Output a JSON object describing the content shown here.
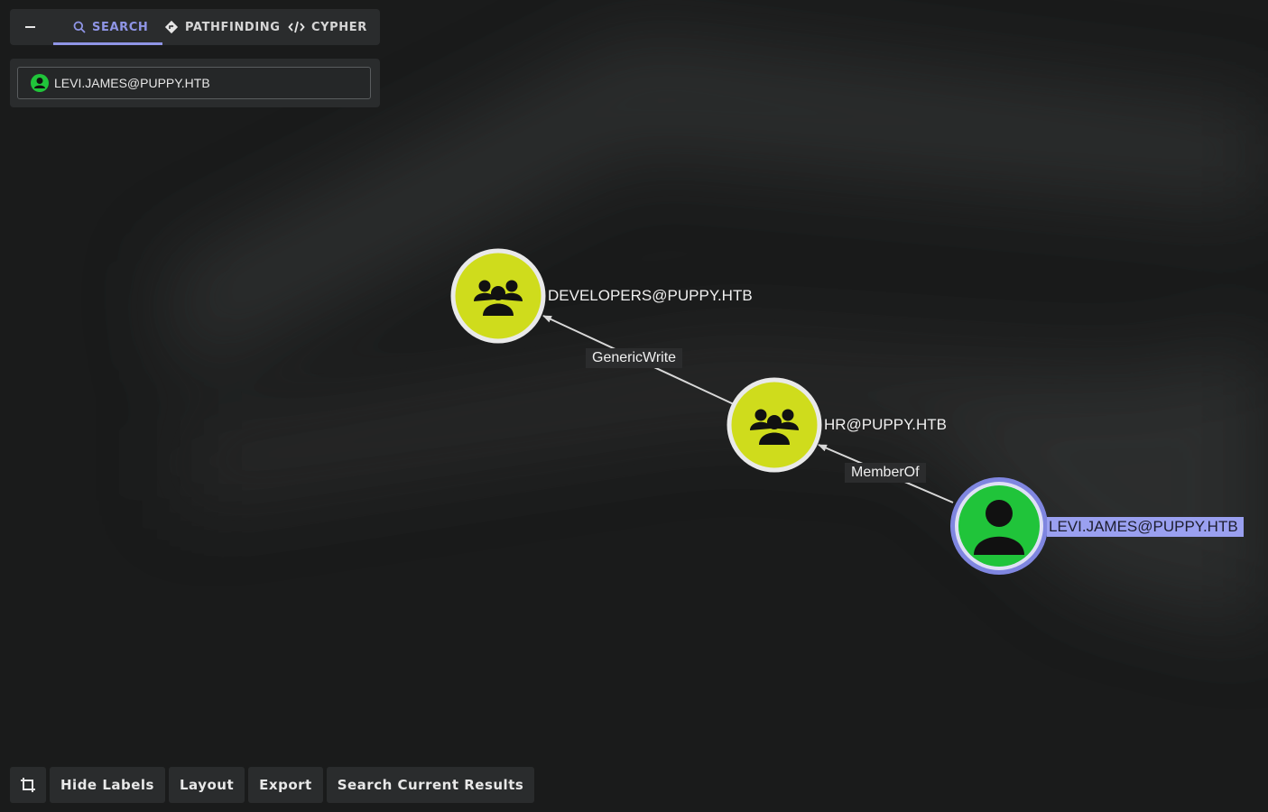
{
  "tabs": [
    {
      "label": "SEARCH",
      "icon": "search-icon",
      "active": true
    },
    {
      "label": "PATHFINDING",
      "icon": "pathfinding-icon",
      "active": false
    },
    {
      "label": "CYPHER",
      "icon": "code-icon",
      "active": false
    }
  ],
  "search": {
    "value": "LEVI.JAMES@PUPPY.HTB",
    "icon": "user-icon"
  },
  "graph": {
    "nodes": [
      {
        "id": "developers",
        "label": "DEVELOPERS@PUPPY.HTB",
        "type": "group",
        "selected": false
      },
      {
        "id": "hr",
        "label": "HR@PUPPY.HTB",
        "type": "group",
        "selected": false
      },
      {
        "id": "levi",
        "label": "LEVI.JAMES@PUPPY.HTB",
        "type": "user",
        "selected": true
      }
    ],
    "edges": [
      {
        "from": "hr",
        "to": "developers",
        "label": "GenericWrite"
      },
      {
        "from": "levi",
        "to": "hr",
        "label": "MemberOf"
      }
    ]
  },
  "toolbar": {
    "crop_icon": "crop-icon",
    "hide_labels": "Hide Labels",
    "layout": "Layout",
    "export": "Export",
    "search_results": "Search Current Results"
  },
  "colors": {
    "accent": "#8f95e6",
    "group_node": "#cfdc1c",
    "user_node": "#20c43a",
    "selected_label_bg": "#9aa0f0"
  }
}
